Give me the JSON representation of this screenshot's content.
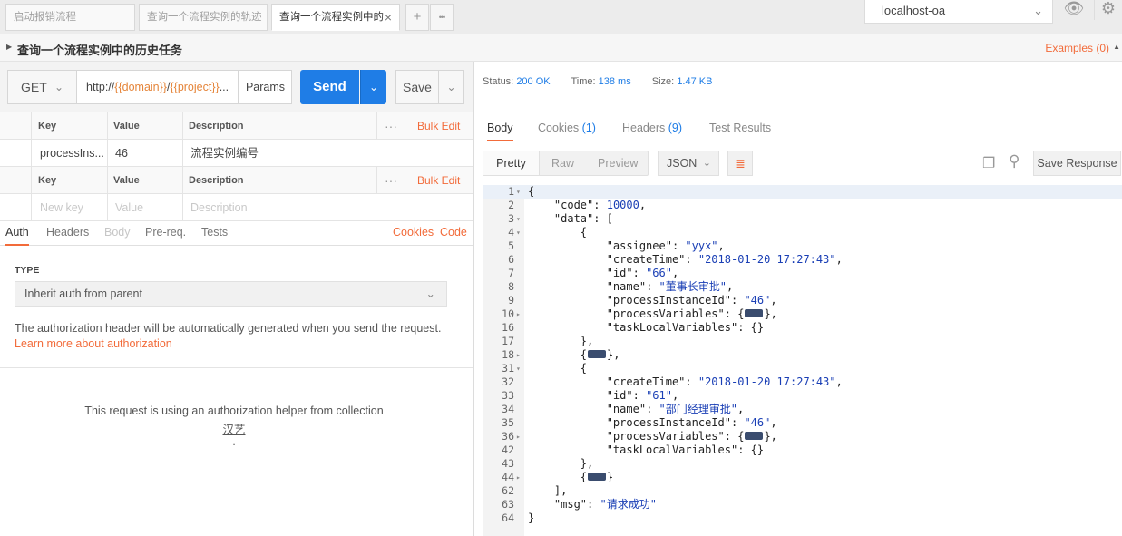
{
  "tabs": [
    {
      "label": "启动报销流程",
      "active": false
    },
    {
      "label": "查询一个流程实例的轨迹",
      "active": false
    },
    {
      "label": "查询一个流程实例中的",
      "active": true
    }
  ],
  "tab_add": "+",
  "tab_more": "•••",
  "environment": "localhost-oa",
  "request_title": "查询一个流程实例中的历史任务",
  "examples_label": "Examples (0)",
  "method": "GET",
  "url": {
    "prefix": "http://",
    "domain": "{{domain}}",
    "slash": "/",
    "project": "{{project}}",
    "rest": "..."
  },
  "params_label": "Params",
  "send_label": "Send",
  "save_label": "Save",
  "params_table": {
    "headers": [
      "Key",
      "Value",
      "Description"
    ],
    "bulk_edit": "Bulk Edit",
    "rows": [
      {
        "key": "processIns...",
        "value": "46",
        "description": "流程实例编号"
      }
    ],
    "headers2": [
      "Key",
      "Value",
      "Description"
    ],
    "placeholders": {
      "key": "New key",
      "value": "Value",
      "description": "Description"
    }
  },
  "request_tabs": [
    "Auth",
    "Headers",
    "Body",
    "Pre-req.",
    "Tests"
  ],
  "cookies_label": "Cookies",
  "code_label": "Code",
  "auth": {
    "type_label": "TYPE",
    "type_value": "Inherit auth from parent",
    "info": "The authorization header will be automatically generated when you send the request.",
    "learn_more": "Learn more about authorization",
    "helper": "This request is using an authorization helper from collection",
    "collection": "汉艺",
    "dot": "."
  },
  "response": {
    "status_label": "Status:",
    "status_value": "200 OK",
    "time_label": "Time:",
    "time_value": "138 ms",
    "size_label": "Size:",
    "size_value": "1.47 KB",
    "tabs": {
      "body": "Body",
      "cookies": "Cookies",
      "cookies_count": "(1)",
      "headers": "Headers",
      "headers_count": "(9)",
      "tests": "Test Results"
    },
    "formats": [
      "Pretty",
      "Raw",
      "Preview"
    ],
    "lang": "JSON",
    "save_response": "Save Response"
  },
  "code_lines": [
    {
      "n": "1",
      "f": "▾",
      "t": "{",
      "hl": true
    },
    {
      "n": "2",
      "f": "",
      "t": "    <span class=\"k\">\"code\"</span>: <span class=\"n\">10000</span>,"
    },
    {
      "n": "3",
      "f": "▾",
      "t": "    <span class=\"k\">\"data\"</span>: ["
    },
    {
      "n": "4",
      "f": "▾",
      "t": "        {"
    },
    {
      "n": "5",
      "f": "",
      "t": "            <span class=\"k\">\"assignee\"</span>: <span class=\"s\">\"yyx\"</span>,"
    },
    {
      "n": "6",
      "f": "",
      "t": "            <span class=\"k\">\"createTime\"</span>: <span class=\"s\">\"2018-01-20 17:27:43\"</span>,"
    },
    {
      "n": "7",
      "f": "",
      "t": "            <span class=\"k\">\"id\"</span>: <span class=\"s\">\"66\"</span>,"
    },
    {
      "n": "8",
      "f": "",
      "t": "            <span class=\"k\">\"name\"</span>: <span class=\"s\">\"董事长审批\"</span>,"
    },
    {
      "n": "9",
      "f": "",
      "t": "            <span class=\"k\">\"processInstanceId\"</span>: <span class=\"s\">\"46\"</span>,"
    },
    {
      "n": "10",
      "f": "▸",
      "t": "            <span class=\"k\">\"processVariables\"</span>: {<span class=\"coll\"></span>},"
    },
    {
      "n": "16",
      "f": "",
      "t": "            <span class=\"k\">\"taskLocalVariables\"</span>: {}"
    },
    {
      "n": "17",
      "f": "",
      "t": "        },"
    },
    {
      "n": "18",
      "f": "▸",
      "t": "        {<span class=\"coll\"></span>},"
    },
    {
      "n": "31",
      "f": "▾",
      "t": "        {"
    },
    {
      "n": "32",
      "f": "",
      "t": "            <span class=\"k\">\"createTime\"</span>: <span class=\"s\">\"2018-01-20 17:27:43\"</span>,"
    },
    {
      "n": "33",
      "f": "",
      "t": "            <span class=\"k\">\"id\"</span>: <span class=\"s\">\"61\"</span>,"
    },
    {
      "n": "34",
      "f": "",
      "t": "            <span class=\"k\">\"name\"</span>: <span class=\"s\">\"部门经理审批\"</span>,"
    },
    {
      "n": "35",
      "f": "",
      "t": "            <span class=\"k\">\"processInstanceId\"</span>: <span class=\"s\">\"46\"</span>,"
    },
    {
      "n": "36",
      "f": "▸",
      "t": "            <span class=\"k\">\"processVariables\"</span>: {<span class=\"coll\"></span>},"
    },
    {
      "n": "42",
      "f": "",
      "t": "            <span class=\"k\">\"taskLocalVariables\"</span>: {}"
    },
    {
      "n": "43",
      "f": "",
      "t": "        },"
    },
    {
      "n": "44",
      "f": "▸",
      "t": "        {<span class=\"coll\"></span>}"
    },
    {
      "n": "62",
      "f": "",
      "t": "    ],"
    },
    {
      "n": "63",
      "f": "",
      "t": "    <span class=\"k\">\"msg\"</span>: <span class=\"s\">\"请求成功\"</span>"
    },
    {
      "n": "64",
      "f": "",
      "t": "}"
    }
  ]
}
